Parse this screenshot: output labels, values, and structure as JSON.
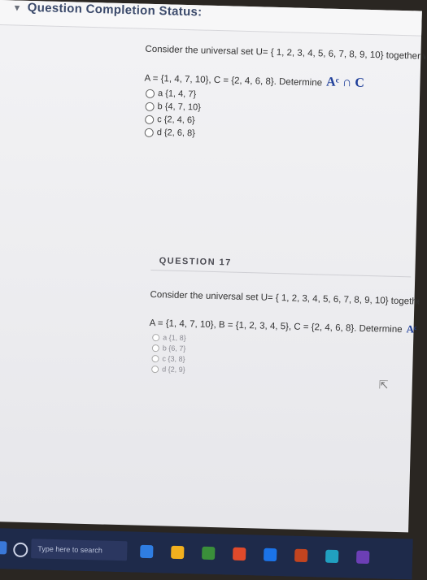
{
  "header": {
    "title": "Question Completion Status:",
    "icon": "collapse-arrow-icon"
  },
  "q16": {
    "intro": "Consider the universal set U= { 1, 2, 3, 4, 5, 6, 7, 8, 9, 10} together with subsets",
    "sets": "A = {1, 4, 7, 10}, C = {2, 4, 6, 8}. Determine",
    "formula": "Aᶜ ∩ C",
    "options": [
      "a {1, 4, 7}",
      "b {4, 7, 10}",
      "c {2, 4, 6}",
      "d {2, 6, 8}"
    ]
  },
  "q17": {
    "label": "QUESTION 17",
    "intro": "Consider the universal set U= { 1, 2, 3, 4, 5, 6, 7, 8, 9, 10} together with subsets",
    "sets": "A = {1, 4, 7, 10}, B = {1, 2, 3, 4, 5}, C = {2, 4, 6, 8}. Determine",
    "formula": "Aᶜ \\ (B ⊕ C)",
    "options": [
      "a {1, 8}",
      "b {6, 7}",
      "c {3, 8}",
      "d {2, 9}"
    ]
  },
  "taskbar": {
    "search_placeholder": "Type here to search",
    "colors": [
      "#2f7de1",
      "#f2b01e",
      "#3a8f3a",
      "#e04a2b",
      "#1b73e8",
      "#c2441f",
      "#21a0c0",
      "#6c3fb5"
    ]
  }
}
